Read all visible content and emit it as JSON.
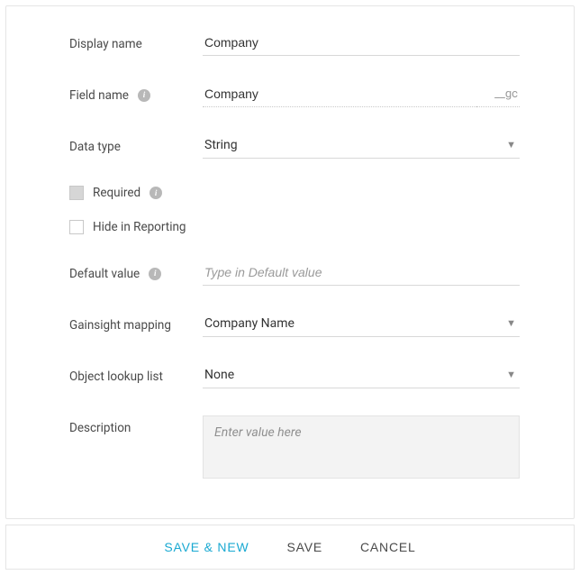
{
  "labels": {
    "displayName": "Display name",
    "fieldName": "Field name",
    "dataType": "Data type",
    "required": "Required",
    "hideInReporting": "Hide in Reporting",
    "defaultValue": "Default value",
    "gainsightMapping": "Gainsight mapping",
    "objectLookupList": "Object lookup list",
    "description": "Description"
  },
  "values": {
    "displayName": "Company",
    "fieldName": "Company",
    "fieldNameSuffix": "__gc",
    "dataType": "String",
    "defaultValue": "",
    "gainsightMapping": "Company Name",
    "objectLookupList": "None",
    "description": ""
  },
  "placeholders": {
    "defaultValue": "Type in Default value",
    "description": "Enter value here"
  },
  "checkboxes": {
    "required": false,
    "requiredDisabled": true,
    "hideInReporting": false
  },
  "icons": {
    "info": "i",
    "dropdown": "▼"
  },
  "footer": {
    "saveNew": "SAVE & NEW",
    "save": "SAVE",
    "cancel": "CANCEL"
  }
}
